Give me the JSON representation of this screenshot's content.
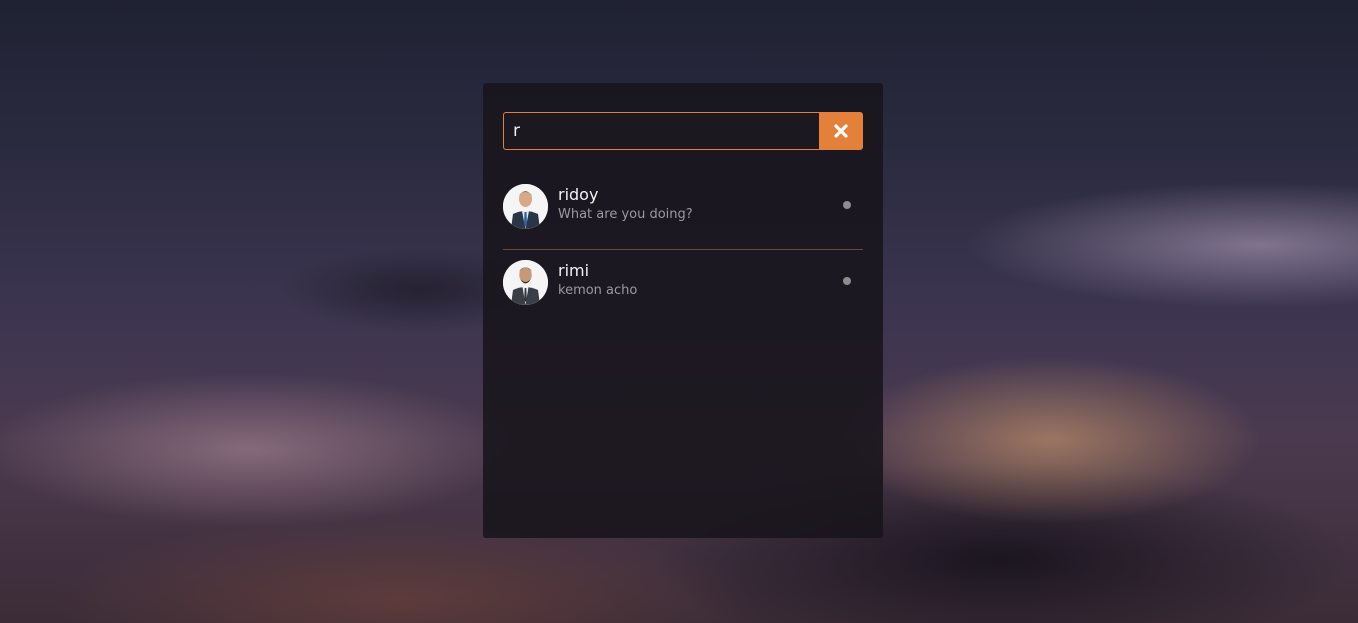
{
  "search": {
    "value": "r",
    "clear_icon": "close-icon"
  },
  "contacts": [
    {
      "name": "ridoy",
      "message": "What are you doing?",
      "avatar_icon": "avatar",
      "status_icon": "status-dot"
    },
    {
      "name": "rimi",
      "message": "kemon acho",
      "avatar_icon": "avatar",
      "status_icon": "status-dot"
    }
  ],
  "colors": {
    "accent": "#e3803a",
    "panel": "#18141b",
    "separator": "#6b4a35",
    "status": "#8d8d90"
  }
}
